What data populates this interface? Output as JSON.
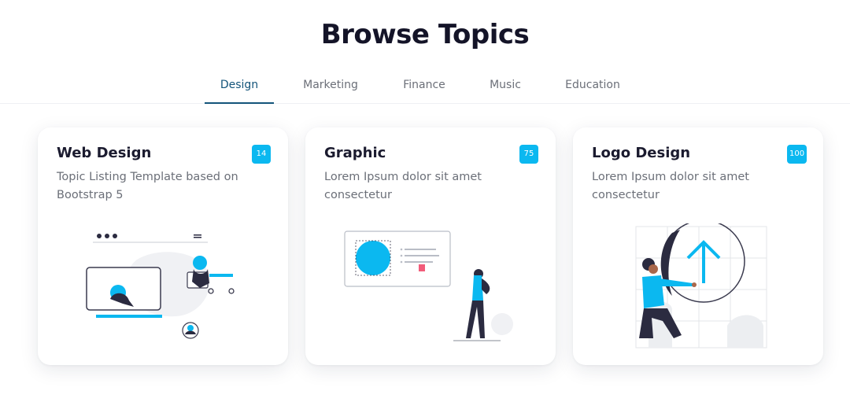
{
  "header": {
    "title": "Browse Topics"
  },
  "tabs": [
    {
      "label": "Design",
      "active": true
    },
    {
      "label": "Marketing"
    },
    {
      "label": "Finance"
    },
    {
      "label": "Music"
    },
    {
      "label": "Education"
    }
  ],
  "cards": [
    {
      "title": "Web Design",
      "description": "Topic Listing Template based on Bootstrap 5",
      "badge": "14",
      "illustration": "web-design-illustration"
    },
    {
      "title": "Graphic",
      "description": "Lorem Ipsum dolor sit amet consectetur",
      "badge": "75",
      "illustration": "graphic-illustration"
    },
    {
      "title": "Logo Design",
      "description": "Lorem Ipsum dolor sit amet consectetur",
      "badge": "100",
      "illustration": "logo-design-illustration"
    }
  ],
  "colors": {
    "accent": "#0bb8f0",
    "tab_active": "#13547a",
    "title": "#141428",
    "muted": "#6b6f78"
  }
}
